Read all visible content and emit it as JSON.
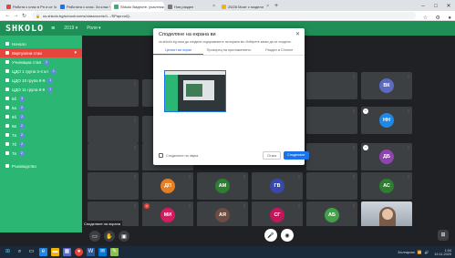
{
  "browser": {
    "tabs": [
      {
        "label": "Работа с клас в Рп и се Чест",
        "color": "#e8453c"
      },
      {
        "label": "Работата с клас. За клас Чест",
        "color": "#1a73e8"
      },
      {
        "label": "Shkolo Видеоте. участник",
        "color": "#2bb673",
        "active": true
      },
      {
        "label": "Нов раздел",
        "color": "#777777"
      },
      {
        "label": "25/28 Моят с модели",
        "color": "#f4b400"
      }
    ],
    "new_tab": "+",
    "url": "us.shkolo.bg/schooIrooms/classrooms/1.../SPaprvolQ.."
  },
  "app": {
    "logo": "SHKOLO",
    "header_items": [
      "2019 ▾",
      "Роля ▾"
    ]
  },
  "sidebar": {
    "items": [
      {
        "label": "Начало",
        "badge": "",
        "active": false
      },
      {
        "label": "Виртуални стаи",
        "badge": "",
        "active": true,
        "chev": "▾"
      },
      {
        "label": "Училищна стая",
        "badge": "1"
      },
      {
        "label": "ЦДО 1 група 3-4 кл",
        "badge": "1"
      },
      {
        "label": "ЦДО 10 група 8-9",
        "badge": "1"
      },
      {
        "label": "ЦДО 11 група 8-9",
        "badge": "1"
      },
      {
        "label": "5б",
        "badge": "3"
      },
      {
        "label": "5а",
        "badge": "2"
      },
      {
        "label": "6б",
        "badge": "2"
      },
      {
        "label": "6в",
        "badge": "2"
      },
      {
        "label": "7а",
        "badge": "2"
      },
      {
        "label": "7б",
        "badge": "2"
      },
      {
        "label": "7в",
        "badge": "2"
      },
      {
        "label": "Ръководство",
        "badge": "",
        "gap": true
      }
    ]
  },
  "meeting": {
    "participants": [
      {
        "initials": "ВК",
        "color": "#5c6bc0"
      },
      {
        "initials": "НН",
        "color": "#1e88e5"
      },
      {
        "initials": "ДБ",
        "color": "#8e44ad"
      },
      {
        "initials": "ДП",
        "color": "#e67e22"
      },
      {
        "initials": "АМ",
        "color": "#2e7d32"
      },
      {
        "initials": "ГВ",
        "color": "#3949ab"
      },
      {
        "initials": "АС",
        "color": "#2e7d32"
      },
      {
        "initials": "МИ",
        "color": "#d81b60"
      },
      {
        "initials": "АЯ",
        "color": "#6d4c41"
      },
      {
        "initials": "СГ",
        "color": "#c2185b"
      },
      {
        "initials": "АБ",
        "color": "#43a047"
      }
    ],
    "caption": "Споделяне на екрана"
  },
  "dialog": {
    "title": "Споделяне на екрана ви",
    "description": "us.shkolo.bg иска да сподели съдържанието на екрана ви. Изберете какво да се споделя.",
    "tabs": [
      "Целият ви екран",
      "Прозорец на приложението",
      "Раздел в Chrome"
    ],
    "checkbox_label": "Споделяне на звука",
    "cancel_label": "Отказ",
    "share_label": "Споделяне"
  },
  "taskbar": {
    "tray_text": "Български",
    "time": "1:04",
    "date": "19.11.2020"
  }
}
